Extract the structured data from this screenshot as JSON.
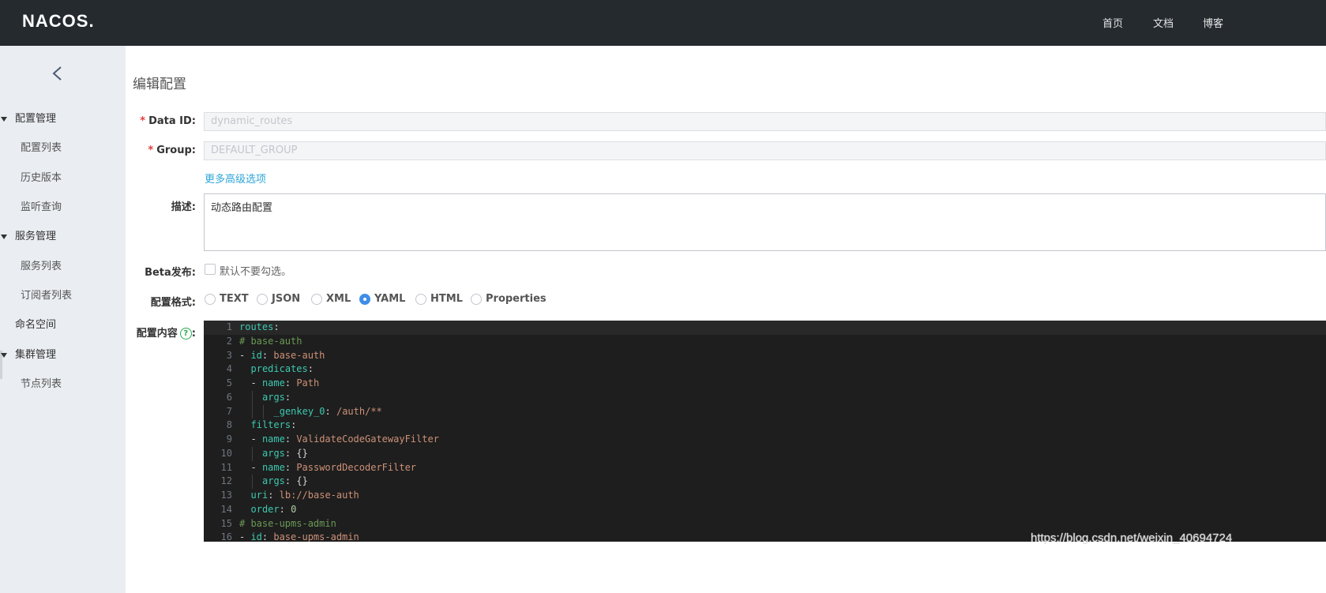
{
  "header": {
    "logo_text": "NACOS.",
    "nav": [
      "首页",
      "文档",
      "博客"
    ]
  },
  "sidebar": {
    "groups": [
      {
        "label": "配置管理",
        "items": [
          "配置列表",
          "历史版本",
          "监听查询"
        ]
      },
      {
        "label": "服务管理",
        "items": [
          "服务列表",
          "订阅者列表"
        ]
      },
      {
        "label": "命名空间",
        "items": []
      },
      {
        "label": "集群管理",
        "items": [
          "节点列表"
        ]
      }
    ]
  },
  "form": {
    "title": "编辑配置",
    "data_id_label": "Data ID:",
    "data_id_value": "dynamic_routes",
    "group_label": "Group:",
    "group_value": "DEFAULT_GROUP",
    "advanced_link": "更多高级选项",
    "desc_label": "描述:",
    "desc_value": "动态路由配置",
    "beta_label": "Beta发布:",
    "beta_text": "默认不要勾选。",
    "format_label": "配置格式:",
    "formats": [
      "TEXT",
      "JSON",
      "XML",
      "YAML",
      "HTML",
      "Properties"
    ],
    "selected_format": "YAML",
    "content_label": "配置内容",
    "required_mark": "*",
    "help_mark": "?",
    "colon": ":"
  },
  "editor": {
    "lines": [
      {
        "no": "1",
        "indent": 0,
        "tokens": [
          [
            "k",
            "routes"
          ],
          [
            "p",
            ":"
          ]
        ]
      },
      {
        "no": "2",
        "indent": 0,
        "tokens": [
          [
            "c",
            "# base-auth"
          ]
        ]
      },
      {
        "no": "3",
        "indent": 0,
        "tokens": [
          [
            "p",
            "- "
          ],
          [
            "k",
            "id"
          ],
          [
            "p",
            ": "
          ],
          [
            "v",
            "base-auth"
          ]
        ]
      },
      {
        "no": "4",
        "indent": 1,
        "tokens": [
          [
            "k",
            "predicates"
          ],
          [
            "p",
            ":"
          ]
        ]
      },
      {
        "no": "5",
        "indent": 1,
        "tokens": [
          [
            "p",
            "- "
          ],
          [
            "k",
            "name"
          ],
          [
            "p",
            ": "
          ],
          [
            "v",
            "Path"
          ]
        ]
      },
      {
        "no": "6",
        "indent": 2,
        "tokens": [
          [
            "k",
            "args"
          ],
          [
            "p",
            ":"
          ]
        ]
      },
      {
        "no": "7",
        "indent": 3,
        "tokens": [
          [
            "k",
            "_genkey_0"
          ],
          [
            "p",
            ": "
          ],
          [
            "v",
            "/auth/**"
          ]
        ]
      },
      {
        "no": "8",
        "indent": 1,
        "tokens": [
          [
            "k",
            "filters"
          ],
          [
            "p",
            ":"
          ]
        ]
      },
      {
        "no": "9",
        "indent": 1,
        "tokens": [
          [
            "p",
            "- "
          ],
          [
            "k",
            "name"
          ],
          [
            "p",
            ": "
          ],
          [
            "v",
            "ValidateCodeGatewayFilter"
          ]
        ]
      },
      {
        "no": "10",
        "indent": 2,
        "tokens": [
          [
            "k",
            "args"
          ],
          [
            "p",
            ": {}"
          ]
        ]
      },
      {
        "no": "11",
        "indent": 1,
        "tokens": [
          [
            "p",
            "- "
          ],
          [
            "k",
            "name"
          ],
          [
            "p",
            ": "
          ],
          [
            "v",
            "PasswordDecoderFilter"
          ]
        ]
      },
      {
        "no": "12",
        "indent": 2,
        "tokens": [
          [
            "k",
            "args"
          ],
          [
            "p",
            ": {}"
          ]
        ]
      },
      {
        "no": "13",
        "indent": 1,
        "tokens": [
          [
            "k",
            "uri"
          ],
          [
            "p",
            ": "
          ],
          [
            "v",
            "lb://base-auth"
          ]
        ]
      },
      {
        "no": "14",
        "indent": 1,
        "tokens": [
          [
            "k",
            "order"
          ],
          [
            "p",
            ": "
          ],
          [
            "n",
            "0"
          ]
        ]
      },
      {
        "no": "15",
        "indent": 0,
        "tokens": [
          [
            "c",
            "# base-upms-admin"
          ]
        ]
      },
      {
        "no": "16",
        "indent": 0,
        "tokens": [
          [
            "p",
            "- "
          ],
          [
            "k",
            "id"
          ],
          [
            "p",
            ": "
          ],
          [
            "v",
            "base-upms-admin"
          ]
        ]
      }
    ]
  },
  "watermark": "https://blog.csdn.net/weixin_40694724"
}
